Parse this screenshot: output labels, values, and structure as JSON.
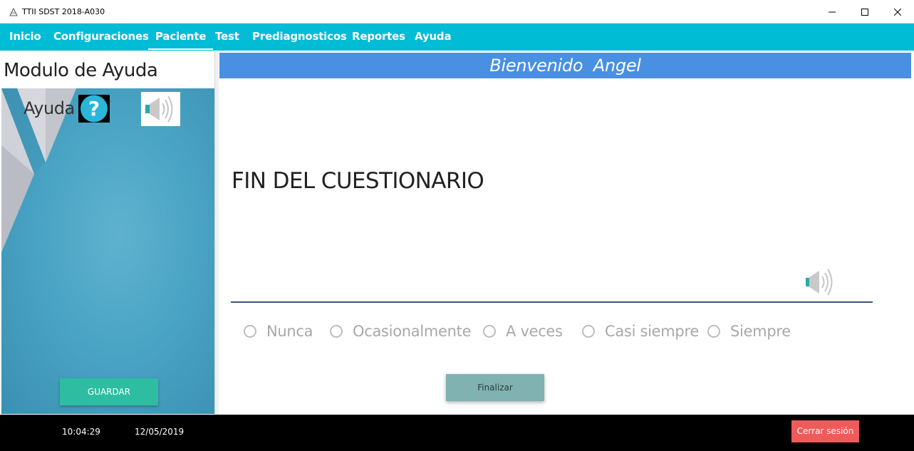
{
  "window": {
    "title": "TTII SDST 2018-A030",
    "app_icon": "app-logo-icon",
    "controls": [
      "minimize-icon",
      "maximize-icon",
      "close-icon"
    ]
  },
  "menu": {
    "items": [
      "Inicio",
      "Configuraciones",
      "Paciente",
      "Test",
      "Prediagnosticos",
      "Reportes",
      "Ayuda"
    ],
    "active": "Paciente"
  },
  "help_panel": {
    "title": "Modulo de Ayuda",
    "ayuda_label": "Ayuda",
    "help_icon": "question-mark-icon",
    "sound_icon": "speaker-icon",
    "save_button": "GUARDAR"
  },
  "main": {
    "welcome": "Bienvenido  Angel",
    "question": "FIN DEL CUESTIONARIO",
    "sound_icon": "speaker-icon",
    "options": [
      "Nunca",
      "Ocasionalmente",
      "A veces",
      "Casi siempre",
      "Siempre"
    ],
    "finish_button": "Finalizar"
  },
  "footer": {
    "time": "10:04:29",
    "date": "12/05/2019",
    "logout_button": "Cerrar sesión"
  },
  "colors": {
    "menu_bar": "#00bcd4",
    "welcome_bar": "#4a90e2",
    "save_button": "#2ebda0",
    "finish_button": "#7fb2b0",
    "logout_button": "#f05a5a",
    "footer": "#000000"
  }
}
